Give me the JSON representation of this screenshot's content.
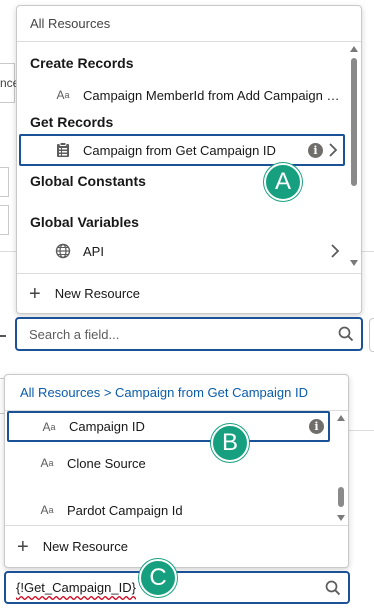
{
  "background": {
    "fragment_text": "nce"
  },
  "panel1": {
    "header": "All Resources",
    "groups": [
      {
        "label": "Create Records"
      },
      {
        "label": "Get Records"
      },
      {
        "label": "Global Constants"
      },
      {
        "label": "Global Variables"
      }
    ],
    "rows": [
      {
        "icon": "text-variable-icon",
        "label": "Campaign MemberId from Add Campaign Me..."
      },
      {
        "icon": "record-list-icon",
        "label": "Campaign from Get Campaign ID"
      },
      {
        "icon": "globe-icon",
        "label": "API"
      }
    ],
    "footer": "New Resource"
  },
  "search1": {
    "placeholder": "Search a field..."
  },
  "panel2": {
    "breadcrumb_root": "All Resources",
    "breadcrumb_sep": ">",
    "breadcrumb_current": "Campaign from Get Campaign ID",
    "rows": [
      {
        "icon": "text-variable-icon",
        "label": "Campaign ID"
      },
      {
        "icon": "text-variable-icon",
        "label": "Clone Source"
      },
      {
        "icon": "text-variable-icon",
        "label": "Pardot Campaign Id"
      }
    ],
    "footer": "New Resource"
  },
  "search2": {
    "value": "{!Get_Campaign_ID}"
  },
  "callouts": {
    "a": "A",
    "b": "B",
    "c": "C"
  },
  "colors": {
    "accent_border": "#1b5297",
    "link": "#0b5cab",
    "callout": "#17a07f",
    "spell_error": "#d0021b"
  }
}
